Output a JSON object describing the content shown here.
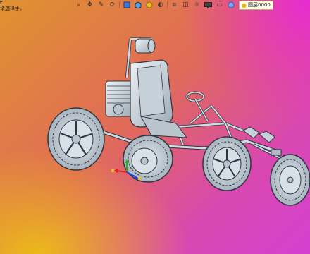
{
  "hint": {
    "line1": "t",
    "line2": "请选择手。"
  },
  "toolbar": {
    "icons": [
      "zoom-icon",
      "pan-icon",
      "sketch-icon",
      "rotate-icon",
      "shade-icon",
      "display-style-icon",
      "appearance-icon",
      "section-icon",
      "view-orientation-icon",
      "hide-show-icon",
      "lights-icon",
      "monitor-icon",
      "render-icon"
    ],
    "search_text": "图层0000"
  },
  "colors": {
    "part_fill": "#c9d3dc",
    "part_edge": "#2c3540",
    "triad_x": "#e02020",
    "triad_y": "#20b020",
    "triad_z": "#2040e0"
  }
}
